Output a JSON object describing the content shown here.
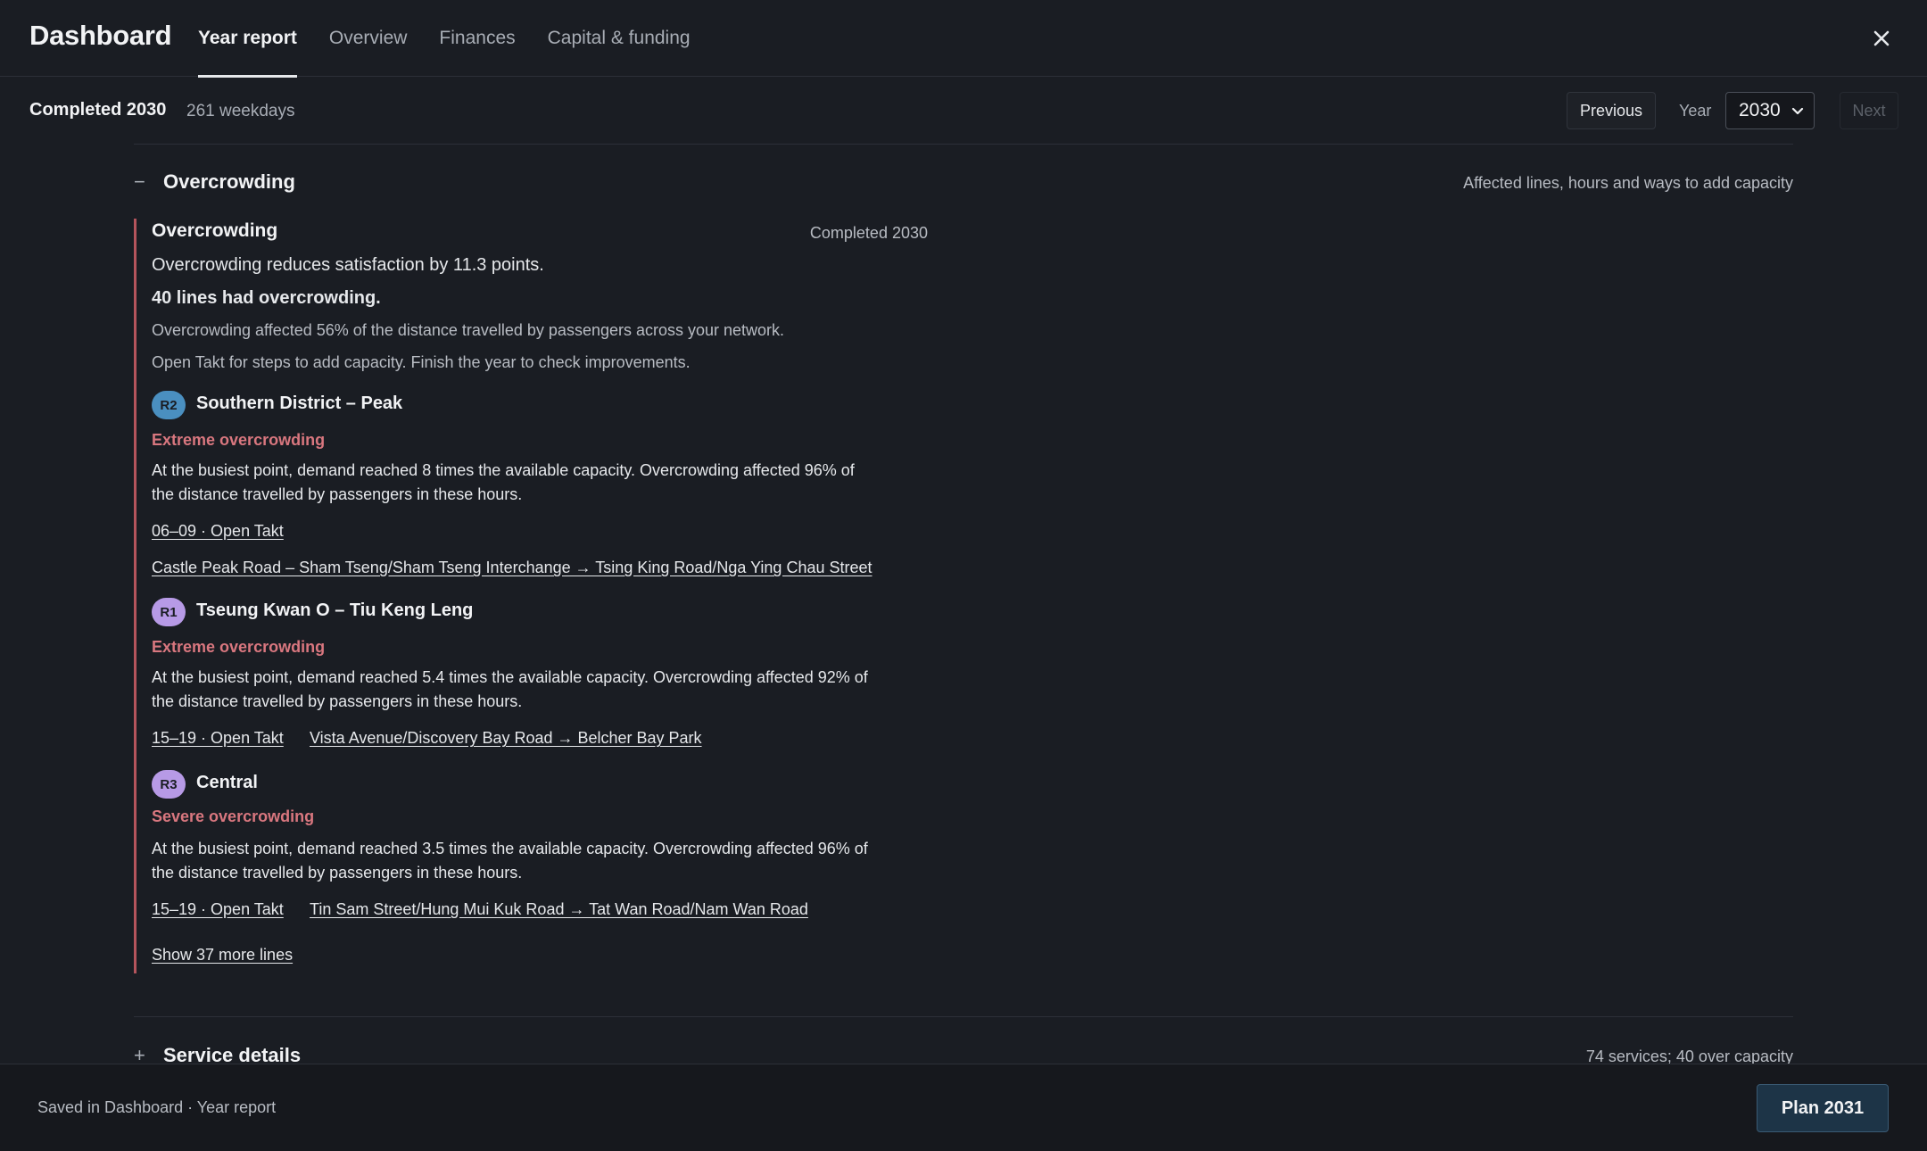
{
  "app": {
    "title": "Dashboard"
  },
  "tabs": [
    {
      "label": "Year report",
      "active": true
    },
    {
      "label": "Overview",
      "active": false
    },
    {
      "label": "Finances",
      "active": false
    },
    {
      "label": "Capital & funding",
      "active": false
    }
  ],
  "subbar": {
    "completed": "Completed 2030",
    "weekdays": "261 weekdays",
    "previous": "Previous",
    "year_label": "Year",
    "year_value": "2030",
    "next": "Next"
  },
  "overcrowding_section": {
    "toggle": "−",
    "title": "Overcrowding",
    "meta": "Affected lines, hours and ways to add capacity",
    "panel": {
      "title": "Overcrowding",
      "status": "Completed 2030",
      "summary": "Overcrowding reduces satisfaction by 11.3 points.",
      "count": "40 lines had overcrowding.",
      "distance": "Overcrowding affected 56% of the distance travelled by passengers across your network.",
      "hint": "Open Takt for steps to add capacity. Finish the year to check improvements.",
      "lines": [
        {
          "badge": "R2",
          "badge_color": "#4a8fc0",
          "name": "Southern District – Peak",
          "severity": "Extreme overcrowding",
          "desc_1": "At the busiest point, demand reached 8 times the available capacity. Overcrowding affected 96% of",
          "desc_2": "the distance travelled by passengers in these hours.",
          "hours_link": "06–09 · Open Takt",
          "route_link": "Castle Peak Road – Sham Tseng/Sham Tseng Interchange → Tsing King Road/Nga Ying Chau Street"
        },
        {
          "badge": "R1",
          "badge_color": "#b79ae6",
          "name": "Tseung Kwan O – Tiu Keng Leng",
          "severity": "Extreme overcrowding",
          "desc_1": "At the busiest point, demand reached 5.4 times the available capacity. Overcrowding affected 92% of",
          "desc_2": "the distance travelled by passengers in these hours.",
          "hours_link": "15–19 · Open Takt",
          "route_link": "Vista Avenue/Discovery Bay Road → Belcher Bay Park"
        },
        {
          "badge": "R3",
          "badge_color": "#b79ae6",
          "name": "Central",
          "severity": "Severe overcrowding",
          "desc_1": "At the busiest point, demand reached 3.5 times the available capacity. Overcrowding affected 96% of",
          "desc_2": "the distance travelled by passengers in these hours.",
          "hours_link": "15–19 · Open Takt",
          "route_link": "Tin Sam Street/Hung Mui Kuk Road → Tat Wan Road/Nam Wan Road"
        }
      ],
      "more_link": "Show 37 more lines"
    }
  },
  "service_section": {
    "toggle": "+",
    "title": "Service details",
    "meta": "74 services; 40 over capacity"
  },
  "footer": {
    "saved": "Saved in Dashboard · Year report",
    "plan_button": "Plan 2031"
  },
  "colors": {
    "accent_severity": "#d9777f",
    "panel_border": "#b4545c",
    "primary_button": "#1d3447"
  }
}
